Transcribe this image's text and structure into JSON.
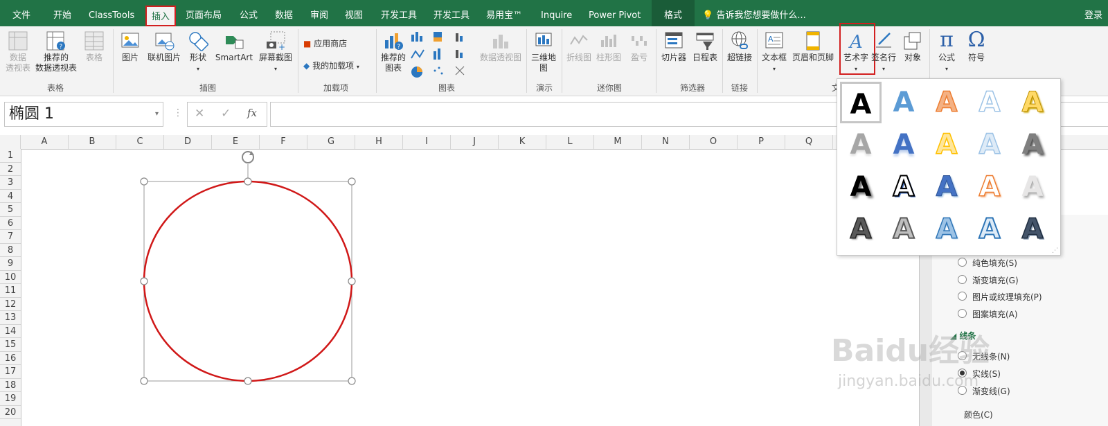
{
  "menubar": {
    "items": [
      "文件",
      "开始",
      "ClassTools",
      "插入",
      "页面布局",
      "公式",
      "数据",
      "审阅",
      "视图",
      "开发工具",
      "开发工具",
      "易用宝™",
      "Inquire",
      "Power Pivot",
      "格式"
    ],
    "tell_me": "告诉我您想要做什么...",
    "login": "登录"
  },
  "ribbon": {
    "tables": {
      "pivot": "数据\n透视表",
      "recommended_pivot": "推荐的\n数据透视表",
      "table": "表格",
      "label": "表格"
    },
    "illustrations": {
      "picture": "图片",
      "online_picture": "联机图片",
      "shapes": "形状",
      "smartart": "SmartArt",
      "screenshot": "屏幕截图",
      "label": "插图"
    },
    "addins": {
      "store": "应用商店",
      "my_addins": "我的加载项",
      "label": "加载项"
    },
    "charts": {
      "recommended": "推荐的\n图表",
      "pivot_chart": "数据透视图",
      "label": "图表"
    },
    "tours": {
      "map3d": "三维地\n图",
      "label": "演示"
    },
    "sparklines": {
      "line": "折线图",
      "column": "柱形图",
      "winloss": "盈亏",
      "label": "迷你图"
    },
    "filters": {
      "slicer": "切片器",
      "timeline": "日程表",
      "label": "筛选器"
    },
    "links": {
      "hyperlink": "超链接",
      "label": "链接"
    },
    "text": {
      "textbox": "文本框",
      "header_footer": "页眉和页脚",
      "wordart": "艺术字",
      "signature": "签名行",
      "object": "对象",
      "label": "文"
    },
    "symbols": {
      "equation": "公式",
      "symbol": "符号"
    }
  },
  "formula_bar": {
    "name_box": "椭圆 1",
    "fx": "fx",
    "cancel": "✕",
    "enter": "✓"
  },
  "grid": {
    "columns": [
      "A",
      "B",
      "C",
      "D",
      "E",
      "F",
      "G",
      "H",
      "I",
      "J",
      "K",
      "L",
      "M",
      "N",
      "O",
      "P",
      "Q"
    ],
    "rows": [
      "1",
      "2",
      "3",
      "4",
      "5",
      "6",
      "7",
      "8",
      "9",
      "10",
      "11",
      "12",
      "13",
      "14",
      "15",
      "16",
      "17",
      "18",
      "19",
      "20"
    ]
  },
  "wordart_gallery": {
    "letter": "A",
    "count": 20
  },
  "format_pane": {
    "fill_options": [
      "纯色填充(S)",
      "渐变填充(G)",
      "图片或纹理填充(P)",
      "图案填充(A)"
    ],
    "line_header": "线条",
    "line_options": [
      "无线条(N)",
      "实线(S)",
      "渐变线(G)"
    ],
    "color_label": "颜色(C)"
  },
  "watermark": {
    "brand": "Baidu经验",
    "url": "jingyan.baidu.com"
  },
  "colors": {
    "excel_green": "#217346",
    "highlight_red": "#d21f1f",
    "shape_outline": "#d01818"
  }
}
